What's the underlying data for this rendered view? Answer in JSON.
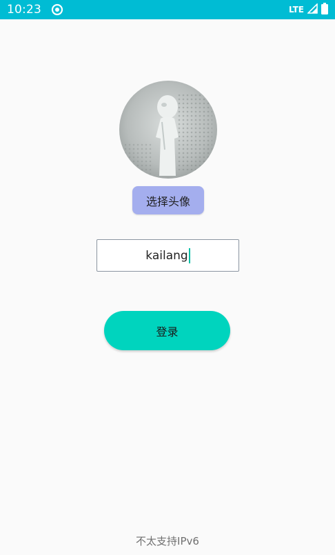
{
  "status_bar": {
    "time": "10:23",
    "network": "LTE",
    "sync_icon": "sync-icon",
    "signal_icon": "signal-icon",
    "battery_icon": "battery-icon"
  },
  "avatar": {
    "icon": "avatar-image"
  },
  "choose_avatar_button": {
    "label": "选择头像"
  },
  "username_input": {
    "value": "kailang"
  },
  "login_button": {
    "label": "登录"
  },
  "footer": {
    "note": "不太支持IPv6"
  },
  "colors": {
    "status_bar": "#00bcd4",
    "choose_button": "#a4aeee",
    "login_button": "#00d4be",
    "caret": "#00bfa5"
  }
}
